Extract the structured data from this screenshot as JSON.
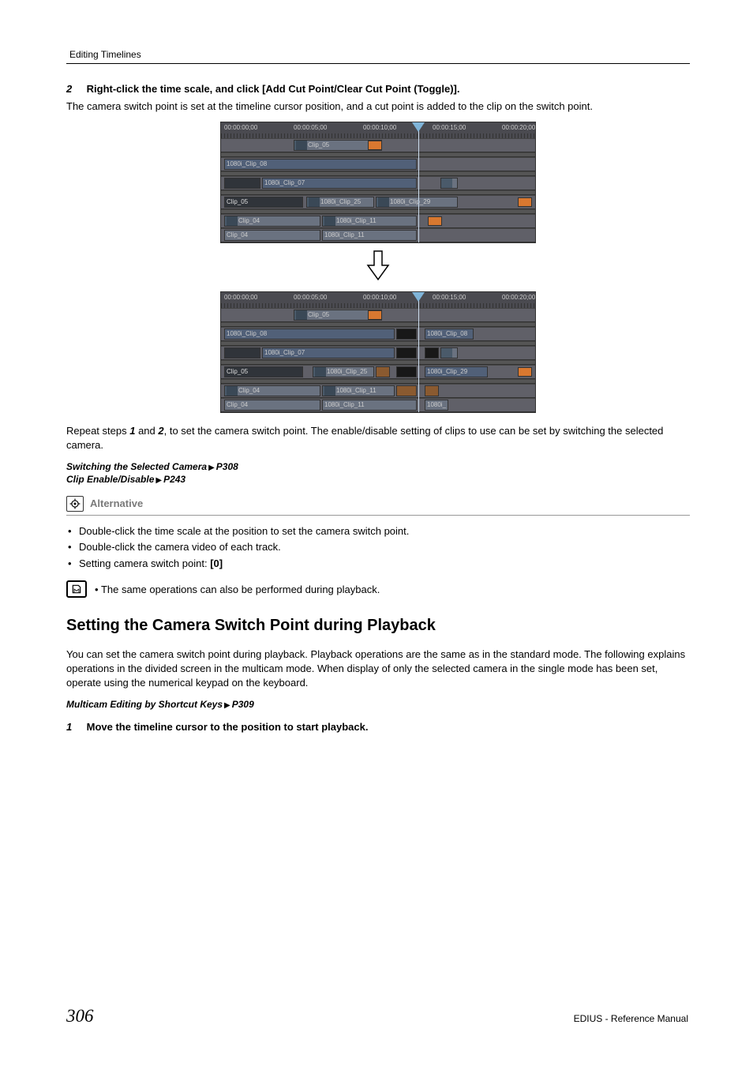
{
  "header": {
    "section": "Editing Timelines"
  },
  "step2": {
    "num": "2",
    "text": "Right-click the time scale, and click [Add Cut Point/Clear Cut Point (Toggle)].",
    "desc": "The camera switch point is set at the timeline cursor position, and a cut point is added to the clip on the switch point."
  },
  "timeline": {
    "ticks": [
      "00:00:00;00",
      "00:00:05;00",
      "00:00:10;00",
      "00:00:15;00",
      "00:00:20;00"
    ],
    "clips_top": {
      "r1a": "Clip_05",
      "r2a": "1080i_Clip_08",
      "r3a": "1080i_Clip_07",
      "r4a": "Clip_05",
      "r4b": "1080i_Clip_25",
      "r4c": "1080i_Clip_29",
      "r5a": "Clip_04",
      "r5b": "1080i_Clip_11",
      "r6a": "Clip_04",
      "r6b": "1080i_Clip_11"
    },
    "clips_bot": {
      "r1a": "Clip_05",
      "r2a": "1080i_Clip_08",
      "r2b": "1080i_Clip_08",
      "r3a": "1080i_Clip_07",
      "r4a": "Clip_05",
      "r4b": "1080i_Clip_25",
      "r4c": "1080i_Clip_29",
      "r5a": "Clip_04",
      "r5b": "1080i_Clip_11",
      "r6a": "Clip_04",
      "r6b": "1080i_Clip_11",
      "r6c": "1080i_"
    }
  },
  "repeat": {
    "pre": "Repeat steps ",
    "s1": "1",
    "mid1": " and ",
    "s2": "2",
    "post": ", to set the camera switch point. The enable/disable setting of clips to use can be set by switching the selected camera."
  },
  "xrefs": {
    "a_label": "Switching the Selected Camera",
    "a_page": "P308",
    "b_label": "Clip Enable/Disable",
    "b_page": "P243"
  },
  "alt": {
    "heading": "Alternative",
    "items": [
      "Double-click the time scale at the position to set the camera switch point.",
      "Double-click the camera video of each track."
    ],
    "last_prefix": "Setting camera switch point: ",
    "last_key": "[0]"
  },
  "note": "The same operations can also be performed during playback.",
  "section2": {
    "title": "Setting the Camera Switch Point during Playback",
    "para": "You can set the camera switch point during playback. Playback operations are the same as in the standard mode. The following explains operations in the divided screen in the multicam mode. When display of only the selected camera in the single mode has been set, operate using the numerical keypad on the keyboard.",
    "xref_label": "Multicam Editing by Shortcut Keys",
    "xref_page": "P309",
    "step1_num": "1",
    "step1_text": "Move the timeline cursor to the position to start playback."
  },
  "footer": {
    "page": "306",
    "manual": "EDIUS - Reference Manual"
  }
}
